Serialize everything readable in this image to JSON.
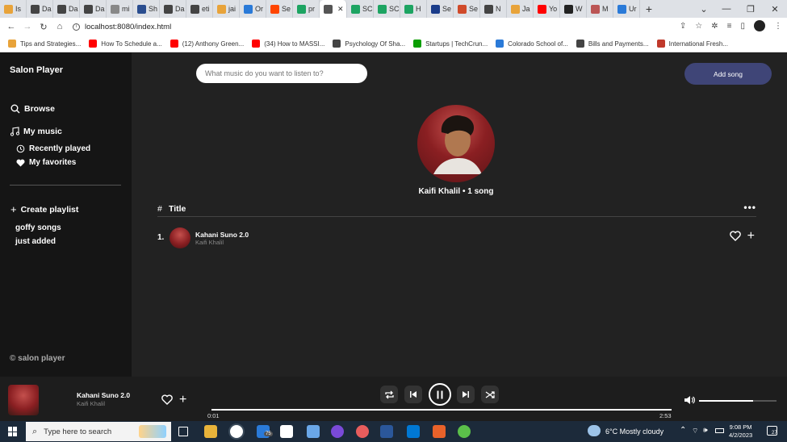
{
  "browser": {
    "tabs": [
      {
        "label": "Is",
        "color": "#e8a33a"
      },
      {
        "label": "Da",
        "color": "#444"
      },
      {
        "label": "Da",
        "color": "#444"
      },
      {
        "label": "Da",
        "color": "#444"
      },
      {
        "label": "mi",
        "color": "#888"
      },
      {
        "label": "Sh",
        "color": "#2a4d8f"
      },
      {
        "label": "Da",
        "color": "#444"
      },
      {
        "label": "eti",
        "color": "#444"
      },
      {
        "label": "jai",
        "color": "#e8a33a"
      },
      {
        "label": "Or",
        "color": "#2a7ad8"
      },
      {
        "label": "Se",
        "color": "#ff4500"
      },
      {
        "label": "pr",
        "color": "#1da462"
      },
      {
        "label": "",
        "color": "#555",
        "active": true
      },
      {
        "label": "SC",
        "color": "#1da462"
      },
      {
        "label": "SC",
        "color": "#1da462"
      },
      {
        "label": "H",
        "color": "#1da462"
      },
      {
        "label": "Se",
        "color": "#1a3c8a"
      },
      {
        "label": "Se",
        "color": "#d04a2a"
      },
      {
        "label": "N",
        "color": "#444"
      },
      {
        "label": "Ja",
        "color": "#e8a33a"
      },
      {
        "label": "Yo",
        "color": "#ff0000"
      },
      {
        "label": "W",
        "color": "#222"
      },
      {
        "label": "M",
        "color": "#b55"
      },
      {
        "label": "Ur",
        "color": "#2a7ad8"
      }
    ],
    "url": "localhost:8080/index.html",
    "bookmarks": [
      {
        "label": "Tips and Strategies...",
        "color": "#e8a33a"
      },
      {
        "label": "How To Schedule a...",
        "color": "#ff0000"
      },
      {
        "label": "(12) Anthony Green...",
        "color": "#ff0000"
      },
      {
        "label": "(34) How to MASSI...",
        "color": "#ff0000"
      },
      {
        "label": "Psychology Of Sha...",
        "color": "#444"
      },
      {
        "label": "Startups | TechCrun...",
        "color": "#0a9e01"
      },
      {
        "label": "Colorado School of...",
        "color": "#2a7ad8"
      },
      {
        "label": "Bills and Payments...",
        "color": "#444"
      },
      {
        "label": "International Fresh...",
        "color": "#c0392b"
      }
    ]
  },
  "app": {
    "brand": "Salon Player",
    "nav": {
      "browse": "Browse",
      "my_music": "My music",
      "recently_played": "Recently played",
      "my_favorites": "My favorites",
      "create_playlist": "Create playlist"
    },
    "playlists": [
      "goffy songs",
      "just added"
    ],
    "footer": "© salon player",
    "search_placeholder": "What music do you want to listen to?",
    "add_song": "Add song",
    "artist_caption": "Kaifi Khalil • 1 song",
    "list": {
      "hash": "#",
      "title_header": "Title",
      "more": "•••",
      "rows": [
        {
          "num": "1.",
          "title": "Kahani Suno 2.0",
          "artist": "Kaifi Khalil"
        }
      ]
    }
  },
  "player": {
    "title": "Kahani Suno 2.0",
    "artist": "Kaifi Khalil",
    "current_time": "0:01",
    "total_time": "2:53",
    "progress": 0.006,
    "volume": 0.7
  },
  "taskbar": {
    "search_placeholder": "Type here to search",
    "weather": "6°C  Mostly cloudy",
    "time": "9:08 PM",
    "date": "4/2/2023",
    "notifications": "27",
    "badge": "75"
  }
}
